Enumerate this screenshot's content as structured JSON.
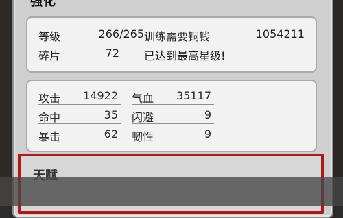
{
  "panel": {
    "title": "强化"
  },
  "info": {
    "level_label": "等级",
    "level_value": "266/265",
    "fragment_label": "碎片",
    "fragment_value": "72",
    "train_cost_label": "训练需要铜钱",
    "train_cost_value": "1054211",
    "max_star_text": "已达到最高星级!"
  },
  "stats": [
    {
      "label": "攻击",
      "value": "14922"
    },
    {
      "label": "气血",
      "value": "35117"
    },
    {
      "label": "命中",
      "value": "35"
    },
    {
      "label": "闪避",
      "value": "9"
    },
    {
      "label": "暴击",
      "value": "62"
    },
    {
      "label": "韧性",
      "value": "9"
    }
  ],
  "red_section": {
    "title": "天赋"
  },
  "colors": {
    "highlight_border": "#b01818",
    "panel_bg": "#cfcfcf",
    "card_bg": "#f2f2f2"
  }
}
